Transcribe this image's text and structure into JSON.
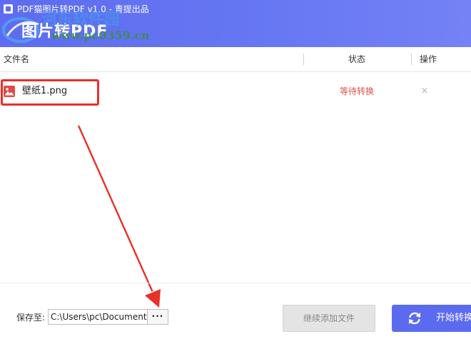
{
  "window": {
    "title": "PDF猫图片转PDF v1.0 - 青提出品",
    "brand_text": "图片转PDF",
    "watermark_site": "河东软件园",
    "watermark_url": "www.pc0359.cn",
    "accent_color": "#5d6cf0"
  },
  "table": {
    "columns": {
      "file_name": "文件名",
      "status": "状态",
      "actions": "操作"
    },
    "rows": [
      {
        "file_name": "壁纸1.png",
        "status": "等待转换",
        "delete_glyph": "×",
        "icon": "image-file-icon"
      }
    ]
  },
  "footer": {
    "save_label": "保存至:",
    "save_path": "C:\\Users\\pc\\Documents",
    "browse_label": "···",
    "add_button": "继续添加文件",
    "start_button": "开始转换",
    "start_icon": "refresh-icon"
  },
  "annotations": {
    "color": "#e8302a"
  }
}
